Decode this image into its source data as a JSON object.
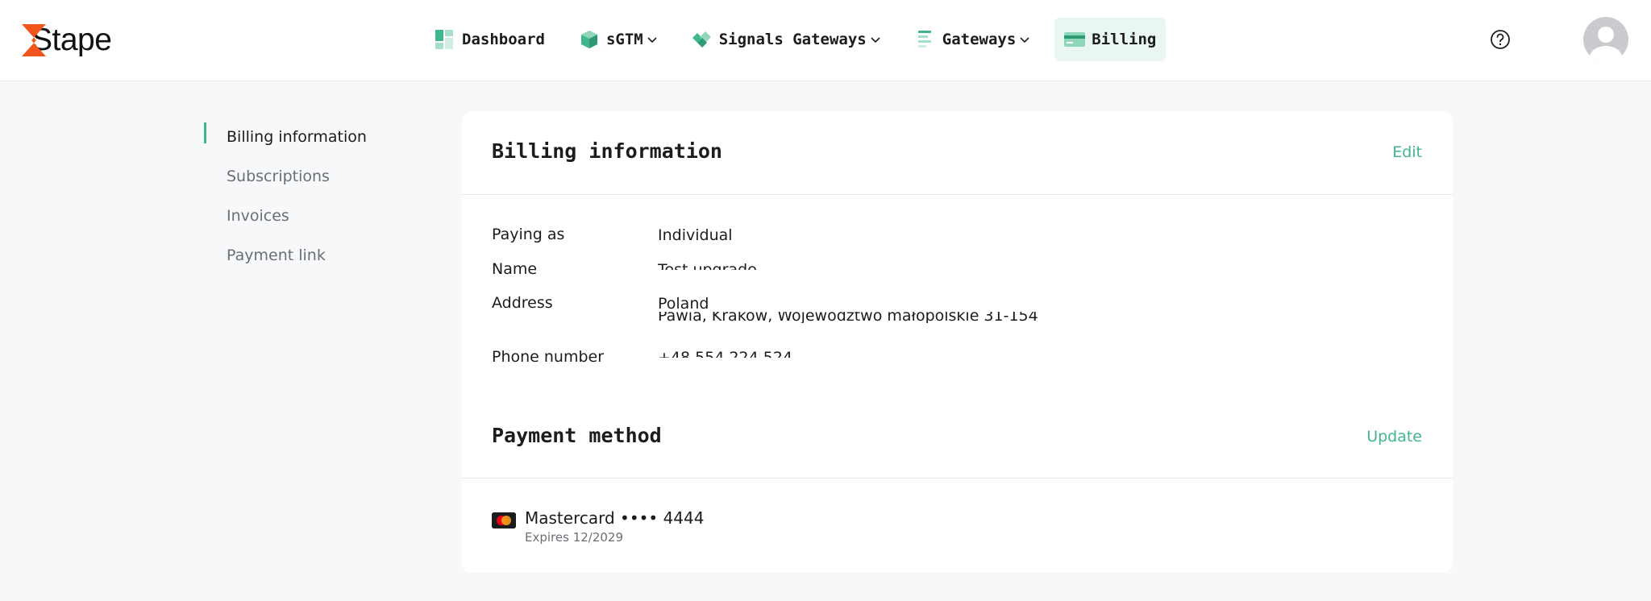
{
  "brand": {
    "name": "Stape",
    "accent": "#3fb68b",
    "logo_color": "#f2561d"
  },
  "nav": {
    "items": [
      {
        "label": "Dashboard",
        "icon": "dashboard-icon",
        "has_menu": false,
        "active": false
      },
      {
        "label": "sGTM",
        "icon": "cube-icon",
        "has_menu": true,
        "active": false
      },
      {
        "label": "Signals Gateways",
        "icon": "diamond-icon",
        "has_menu": true,
        "active": false
      },
      {
        "label": "Gateways",
        "icon": "list-icon",
        "has_menu": true,
        "active": false
      },
      {
        "label": "Billing",
        "icon": "card-icon",
        "has_menu": false,
        "active": true
      }
    ]
  },
  "sidebar": {
    "items": [
      {
        "label": "Billing information",
        "active": true
      },
      {
        "label": "Subscriptions",
        "active": false
      },
      {
        "label": "Invoices",
        "active": false
      },
      {
        "label": "Payment link",
        "active": false
      }
    ]
  },
  "billing": {
    "title": "Billing information",
    "edit_label": "Edit",
    "rows": {
      "paying_as": {
        "label": "Paying as",
        "value": "Individual"
      },
      "name": {
        "label": "Name",
        "value": "Test upgrade"
      },
      "address": {
        "label": "Address",
        "line1": "Poland",
        "line2": "Pawia, Kraków, Województwo małopolskie 31-154"
      },
      "phone": {
        "label": "Phone number",
        "value": "+48 554 224 524"
      }
    }
  },
  "payment": {
    "title": "Payment method",
    "update_label": "Update",
    "card_name": "Mastercard •••• 4444",
    "expires": "Expires 12/2029"
  }
}
